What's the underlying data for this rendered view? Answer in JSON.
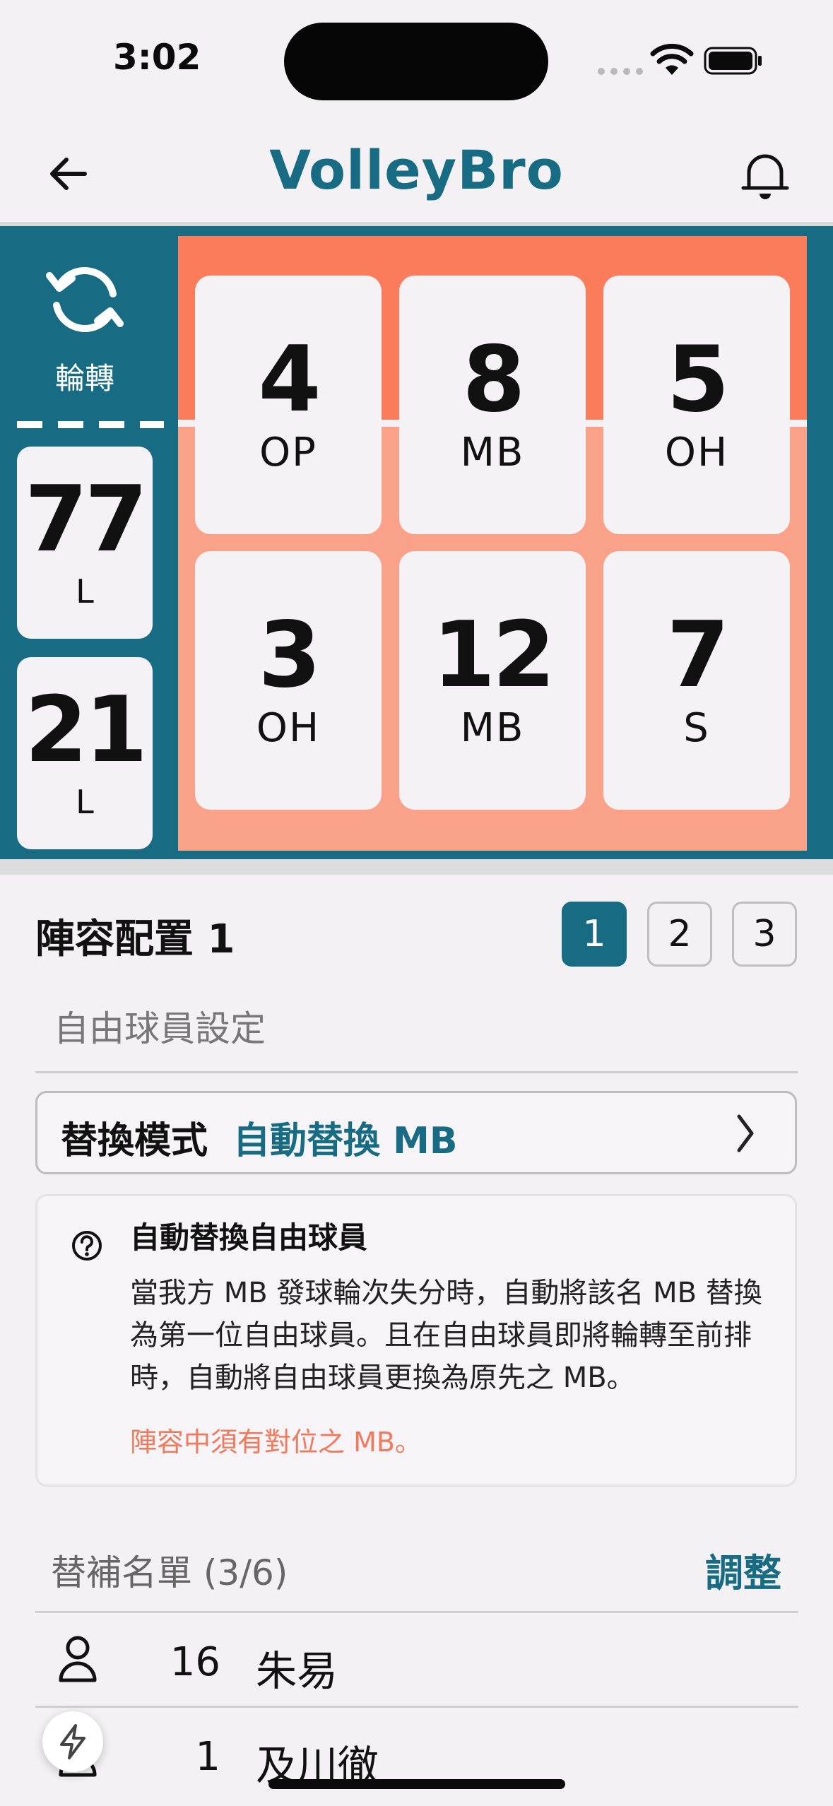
{
  "status_bar": {
    "time": "3:02"
  },
  "nav": {
    "title": "VolleyBro"
  },
  "rotation": {
    "label": "輪轉"
  },
  "liberos": [
    {
      "number": "77",
      "position": "L"
    },
    {
      "number": "21",
      "position": "L"
    }
  ],
  "court": {
    "front_row": [
      {
        "number": "4",
        "position": "OP"
      },
      {
        "number": "8",
        "position": "MB"
      },
      {
        "number": "5",
        "position": "OH"
      }
    ],
    "back_row": [
      {
        "number": "3",
        "position": "OH"
      },
      {
        "number": "12",
        "position": "MB"
      },
      {
        "number": "7",
        "position": "S"
      }
    ]
  },
  "lineup": {
    "title": "陣容配置 1",
    "buttons": [
      "1",
      "2",
      "3"
    ],
    "active": "1"
  },
  "libero_settings": {
    "heading": "自由球員設定",
    "mode_label": "替換模式",
    "mode_value": "自動替換 MB",
    "info_title": "自動替換自由球員",
    "info_body": "當我方 MB 發球輪次失分時，自動將該名 MB 替換為第一位自由球員。且在自由球員即將輪轉至前排時，自動將自由球員更換為原先之 MB。",
    "info_warning": "陣容中須有對位之 MB。"
  },
  "substitutes": {
    "title": "替補名單 (3/6)",
    "adjust_label": "調整",
    "players": [
      {
        "number": "16",
        "name": "朱易"
      },
      {
        "number": "1",
        "name": "及川徹"
      }
    ]
  },
  "colors": {
    "primary": "#176b82",
    "court_front": "#fb7c5a",
    "court_back": "#f9a289",
    "warning": "#f07a5d"
  }
}
